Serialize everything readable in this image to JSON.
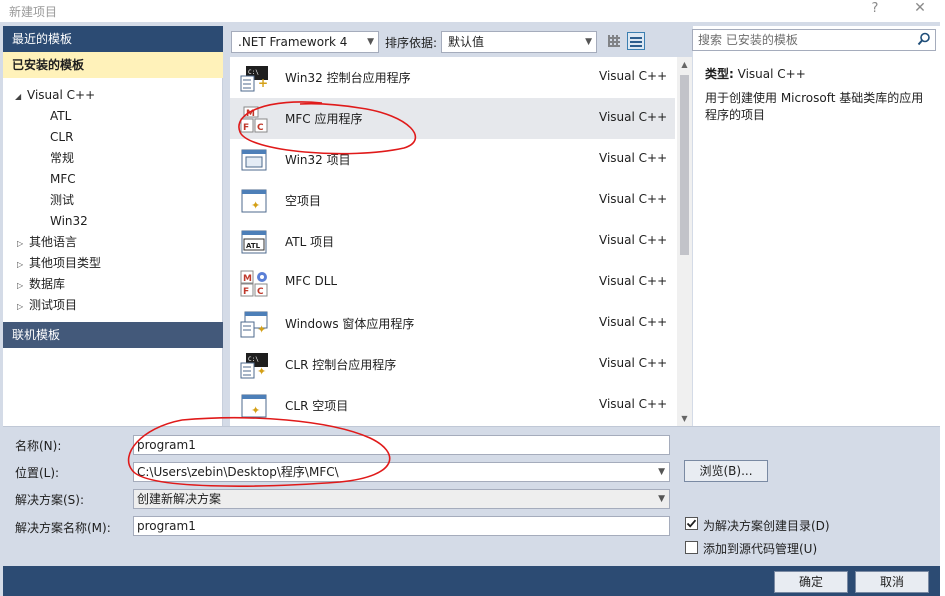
{
  "window": {
    "title": "新建项目",
    "help": "?",
    "close": "✕"
  },
  "left_panel": {
    "recent": "最近的模板",
    "installed": "已安装的模板",
    "tree": [
      {
        "label": "Visual C++",
        "expander": "◢"
      },
      {
        "label": "ATL"
      },
      {
        "label": "CLR"
      },
      {
        "label": "常规"
      },
      {
        "label": "MFC"
      },
      {
        "label": "测试"
      },
      {
        "label": "Win32"
      },
      {
        "label": "其他语言",
        "expander": "▷"
      },
      {
        "label": "其他项目类型",
        "expander": "▷"
      },
      {
        "label": "数据库",
        "expander": "▷"
      },
      {
        "label": "测试项目",
        "expander": "▷"
      }
    ],
    "online": "联机模板"
  },
  "toolbar": {
    "framework": ".NET Framework 4",
    "sort_label": "排序依据:",
    "sort_value": "默认值"
  },
  "projects": [
    {
      "name": "Win32 控制台应用程序",
      "lang": "Visual C++",
      "icon": "console-app-icon"
    },
    {
      "name": "MFC 应用程序",
      "lang": "Visual C++",
      "icon": "mfc-app-icon",
      "selected": true
    },
    {
      "name": "Win32 项目",
      "lang": "Visual C++",
      "icon": "window-icon"
    },
    {
      "name": "空项目",
      "lang": "Visual C++",
      "icon": "empty-project-icon"
    },
    {
      "name": "ATL 项目",
      "lang": "Visual C++",
      "icon": "atl-icon"
    },
    {
      "name": "MFC DLL",
      "lang": "Visual C++",
      "icon": "mfc-dll-icon"
    },
    {
      "name": "Windows 窗体应用程序",
      "lang": "Visual C++",
      "icon": "forms-app-icon"
    },
    {
      "name": "CLR 控制台应用程序",
      "lang": "Visual C++",
      "icon": "clr-console-icon"
    },
    {
      "name": "CLR 空项目",
      "lang": "Visual C++",
      "icon": "clr-empty-icon"
    }
  ],
  "description": {
    "search_placeholder": "搜索 已安装的模板",
    "type_label": "类型:",
    "type_value": "Visual C++",
    "text": "用于创建使用 Microsoft 基础类库的应用程序的项目"
  },
  "form": {
    "name_label": "名称(N):",
    "name_value": "program1",
    "location_label": "位置(L):",
    "location_value": "C:\\Users\\zebin\\Desktop\\程序\\MFC\\",
    "solution_label": "解决方案(S):",
    "solution_value": "创建新解决方案",
    "solution_name_label": "解决方案名称(M):",
    "solution_name_value": "program1",
    "browse": "浏览(B)...",
    "create_dir_label": "为解决方案创建目录(D)",
    "create_dir_checked": true,
    "source_control_label": "添加到源代码管理(U)",
    "source_control_checked": false
  },
  "buttons": {
    "ok": "确定",
    "cancel": "取消"
  },
  "colors": {
    "accent_dark": "#2c4b73",
    "installed_highlight": "#fff2ba",
    "annotation_red": "#e01a1a"
  }
}
